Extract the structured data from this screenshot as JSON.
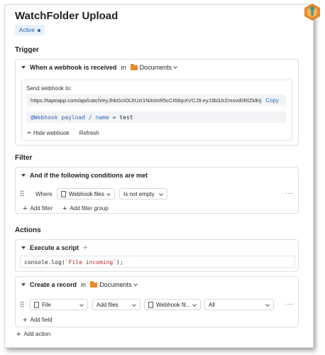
{
  "header": {
    "title": "WatchFolder Upload",
    "status_badge": "Active"
  },
  "trigger": {
    "section_title": "Trigger",
    "event_label": "When a webhook is received",
    "in_label": "in",
    "folder_name": "Documents",
    "send_label": "Send webhook to:",
    "url": "https://tapeapp.com/api/catch/eyJhbGciOiJIUzI1NiIsInR5cCI6IkpXVCJ9.eyJ3b3JrZmxvd0RlZklkIjo",
    "copy_label": "Copy",
    "code": {
      "var": "@Webhook payload / name",
      "op": "=",
      "value": "test"
    },
    "hide_label": "Hide webhook",
    "refresh_label": "Refresh"
  },
  "filter": {
    "section_title": "Filter",
    "condition_label": "And if the following conditions are met",
    "where_label": "Where",
    "field_select": "Webhook files",
    "operator_select": "Is not empty",
    "add_filter_label": "Add filter",
    "add_filter_group_label": "Add filter group",
    "more_label": "···"
  },
  "actions": {
    "section_title": "Actions",
    "script": {
      "label": "Execute a script",
      "code_fn": "console.log(",
      "code_str": "`File incoming`",
      "code_end": ");"
    },
    "record": {
      "label": "Create a record",
      "in_label": "in",
      "folder_name": "Documents",
      "field_select": "File",
      "mode_select": "Add files",
      "source_select": "Webhook fil...",
      "scope_select": "All",
      "add_field_label": "Add field",
      "more_label": "···"
    },
    "add_action_label": "Add action"
  },
  "colors": {
    "accent": "#2d6fc0",
    "folder": "#e8892c",
    "badge_bg": "#e7f0fb"
  }
}
